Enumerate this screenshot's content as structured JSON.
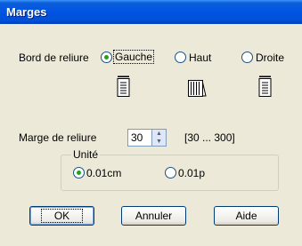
{
  "window": {
    "title": "Marges"
  },
  "binding_edge": {
    "label": "Bord de reliure",
    "options": [
      {
        "label": "Gauche",
        "selected": true
      },
      {
        "label": "Haut",
        "selected": false
      },
      {
        "label": "Droite",
        "selected": false
      }
    ]
  },
  "binding_margin": {
    "label": "Marge de reliure",
    "value": "30",
    "range": "[30 ... 300]"
  },
  "unit": {
    "legend": "Unité",
    "options": [
      {
        "label": "0.01cm",
        "selected": true
      },
      {
        "label": "0.01p",
        "selected": false
      }
    ]
  },
  "buttons": {
    "ok": "OK",
    "cancel": "Annuler",
    "help": "Aide"
  },
  "colors": {
    "titlebar": "#0054e3",
    "dialog_bg": "#ece9d8",
    "radio_dot": "#21a121"
  }
}
